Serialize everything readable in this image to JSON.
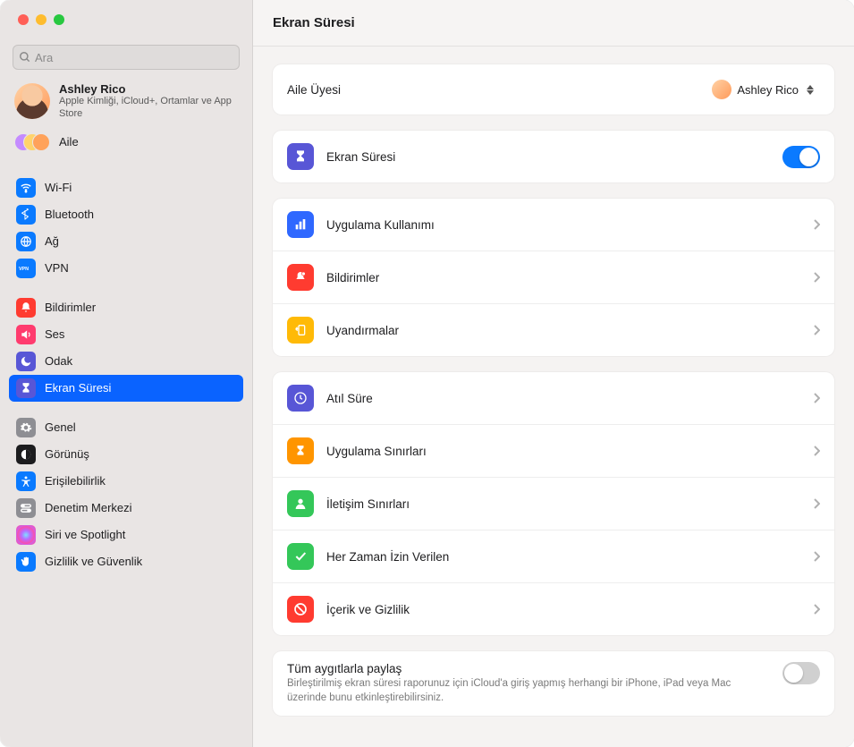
{
  "window": {
    "title": "Ekran Süresi"
  },
  "search": {
    "placeholder": "Ara"
  },
  "account": {
    "name": "Ashley Rico",
    "sub": "Apple Kimliği, iCloud+, Ortamlar ve App Store"
  },
  "family": {
    "label": "Aile"
  },
  "sidebar": {
    "groups": [
      [
        {
          "id": "wifi",
          "label": "Wi-Fi",
          "icon": "wifi-icon",
          "bg": "#0a7aff"
        },
        {
          "id": "bluetooth",
          "label": "Bluetooth",
          "icon": "bluetooth-icon",
          "bg": "#0a7aff"
        },
        {
          "id": "network",
          "label": "Ağ",
          "icon": "globe-icon",
          "bg": "#0a7aff"
        },
        {
          "id": "vpn",
          "label": "VPN",
          "icon": "vpn-icon",
          "bg": "#0a7aff"
        }
      ],
      [
        {
          "id": "notifications",
          "label": "Bildirimler",
          "icon": "bell-icon",
          "bg": "#ff3b30"
        },
        {
          "id": "sound",
          "label": "Ses",
          "icon": "speaker-icon",
          "bg": "#ff3b6e"
        },
        {
          "id": "focus",
          "label": "Odak",
          "icon": "moon-icon",
          "bg": "#5856d6"
        },
        {
          "id": "screentime",
          "label": "Ekran Süresi",
          "icon": "hourglass-icon",
          "bg": "#5856d6",
          "selected": true
        }
      ],
      [
        {
          "id": "general",
          "label": "Genel",
          "icon": "gear-icon",
          "bg": "#8e8e93"
        },
        {
          "id": "appearance",
          "label": "Görünüş",
          "icon": "appearance-icon",
          "bg": "#1c1c1e"
        },
        {
          "id": "accessibility",
          "label": "Erişilebilirlik",
          "icon": "accessibility-icon",
          "bg": "#0a7aff"
        },
        {
          "id": "controlcenter",
          "label": "Denetim Merkezi",
          "icon": "switches-icon",
          "bg": "#8e8e93"
        },
        {
          "id": "siri",
          "label": "Siri ve Spotlight",
          "icon": "siri-icon",
          "bg": "gradient"
        },
        {
          "id": "privacy",
          "label": "Gizlilik ve Güvenlik",
          "icon": "hand-icon",
          "bg": "#0a7aff"
        }
      ]
    ]
  },
  "main": {
    "family_member": {
      "label": "Aile Üyesi",
      "selected": "Ashley Rico"
    },
    "screentime_toggle": {
      "label": "Ekran Süresi",
      "on": true
    },
    "usage_group": [
      {
        "id": "app-usage",
        "label": "Uygulama Kullanımı",
        "icon": "chart-icon",
        "bg": "#2f68ff"
      },
      {
        "id": "notifs",
        "label": "Bildirimler",
        "icon": "bell-badge-icon",
        "bg": "#ff3b30"
      },
      {
        "id": "pickups",
        "label": "Uyandırmalar",
        "icon": "pickup-icon",
        "bg": "#ffba07"
      }
    ],
    "limits_group": [
      {
        "id": "downtime",
        "label": "Atıl Süre",
        "icon": "clock-icon",
        "bg": "#5856d6"
      },
      {
        "id": "app-limits",
        "label": "Uygulama Sınırları",
        "icon": "hourglass-icon",
        "bg": "#ff9500"
      },
      {
        "id": "comm-limits",
        "label": "İletişim Sınırları",
        "icon": "person-icon",
        "bg": "#34c759"
      },
      {
        "id": "always-allowed",
        "label": "Her Zaman İzin Verilen",
        "icon": "check-icon",
        "bg": "#34c759"
      },
      {
        "id": "content-privacy",
        "label": "İçerik ve Gizlilik",
        "icon": "nosign-icon",
        "bg": "#ff3b30"
      }
    ],
    "share": {
      "title": "Tüm aygıtlarla paylaş",
      "sub": "Birleştirilmiş ekran süresi raporunuz için iCloud'a giriş yapmış herhangi bir iPhone, iPad veya Mac üzerinde bunu etkinleştirebilirsiniz.",
      "on": false
    }
  }
}
